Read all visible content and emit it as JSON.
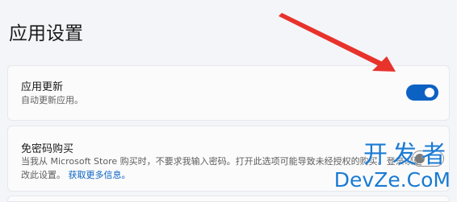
{
  "page": {
    "title": "应用设置"
  },
  "settings": [
    {
      "title": "应用更新",
      "description": "自动更新应用。",
      "toggle": {
        "state": "on"
      }
    },
    {
      "title": "免密码购买",
      "description": "当我从 Microsoft Store 购买时，不要求我输入密码。打开此选项可能导致未经授权的购买。登录以更改此设置。",
      "link": "获取更多信息。",
      "toggle": {
        "state": "off"
      }
    }
  ],
  "watermark": {
    "cn": "开发者",
    "en": "DevZe.CoM"
  },
  "colors": {
    "accent": "#0c62c3",
    "link": "#0a62c4",
    "arrow": "#e8322c",
    "watermark": "#1a7ad3"
  }
}
